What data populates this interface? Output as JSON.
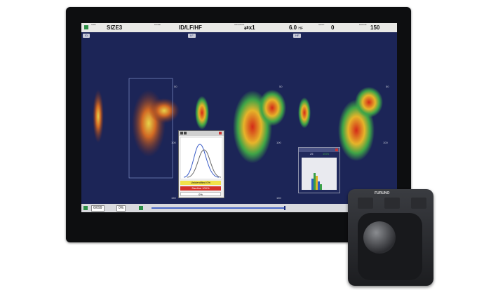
{
  "status_bar": {
    "size_label": "SIZE",
    "size_value": "SIZE3",
    "mode_label": "MODE",
    "mode_value": "ID/LF/HF",
    "advance_label": "ADVANCE",
    "advance_value": "x1",
    "range_value": "6.0",
    "range_unit": "HF",
    "shift_label": "SHIFT",
    "shift_value": "0",
    "range2_label": "RANGE",
    "range2_value": "150"
  },
  "panels": [
    {
      "tag": "ID",
      "scale": [
        "50",
        "100",
        "150"
      ]
    },
    {
      "tag": "LF",
      "scale": [
        "50",
        "100",
        "150"
      ]
    },
    {
      "tag": "HF",
      "scale": [
        "50",
        "100",
        "150"
      ]
    }
  ],
  "dist_popup": {
    "legend_1": "Unidentified 0%",
    "legend_2": "Sardine 100%",
    "legend_3": "0%"
  },
  "hist_popup": {
    "value_1": "25",
    "value_2": "1576"
  },
  "bottom_bar": {
    "counter": "6/099",
    "percent": "0%"
  },
  "hardware": {
    "brand": "FURUNO"
  },
  "colors": {
    "screen_bg": "#1b2350",
    "echo_red": "#c63a1c",
    "echo_green": "#3ea447",
    "echo_yellow": "#e6c426"
  }
}
